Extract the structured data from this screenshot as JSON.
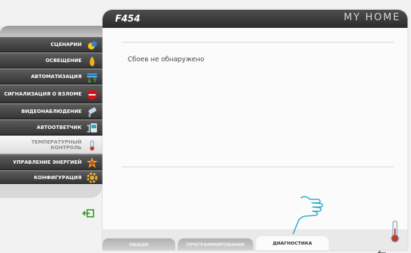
{
  "header": {
    "device_code": "F454",
    "brand": "MY HOME"
  },
  "sidebar": {
    "items": [
      {
        "label": "СЦЕНАРИИ",
        "icon": "scenarios-icon"
      },
      {
        "label": "ОСВЕЩЕНИЕ",
        "icon": "lighting-bulb-icon"
      },
      {
        "label": "АВТОМАТИЗАЦИЯ",
        "icon": "automation-icon"
      },
      {
        "label": "СИГНАЛИЗАЦИЯ О ВЗЛОМЕ",
        "icon": "alarm-icon"
      },
      {
        "label": "ВИДЕОНАБЛЮДЕНИЕ",
        "icon": "camera-icon"
      },
      {
        "label": "АВТООТВЕТЧИК",
        "icon": "answering-machine-icon"
      },
      {
        "label": "ТЕМПЕРАТУРНЫЙ КОНТРОЛЬ",
        "icon": "thermometer-icon",
        "active": true
      },
      {
        "label": "УПРАВЛЕНИЕ ЭНЕРГИЕЙ",
        "icon": "energy-icon"
      },
      {
        "label": "КОНФИГУРАЦИЯ",
        "icon": "gear-icon"
      }
    ]
  },
  "main": {
    "status_message": "Сбоев не обнаружено"
  },
  "tabs": [
    {
      "label": "ОБЩЕЕ"
    },
    {
      "label": "ПРОГРАММИРОВАНИЕ"
    },
    {
      "label": "ДИАГНОСТИКА",
      "selected": true
    }
  ],
  "colors": {
    "header_dark": "#2b2b2b",
    "menu_dark": "#353535",
    "accent_green": "#3aa030",
    "hand_cyan": "#2aa8c8"
  }
}
